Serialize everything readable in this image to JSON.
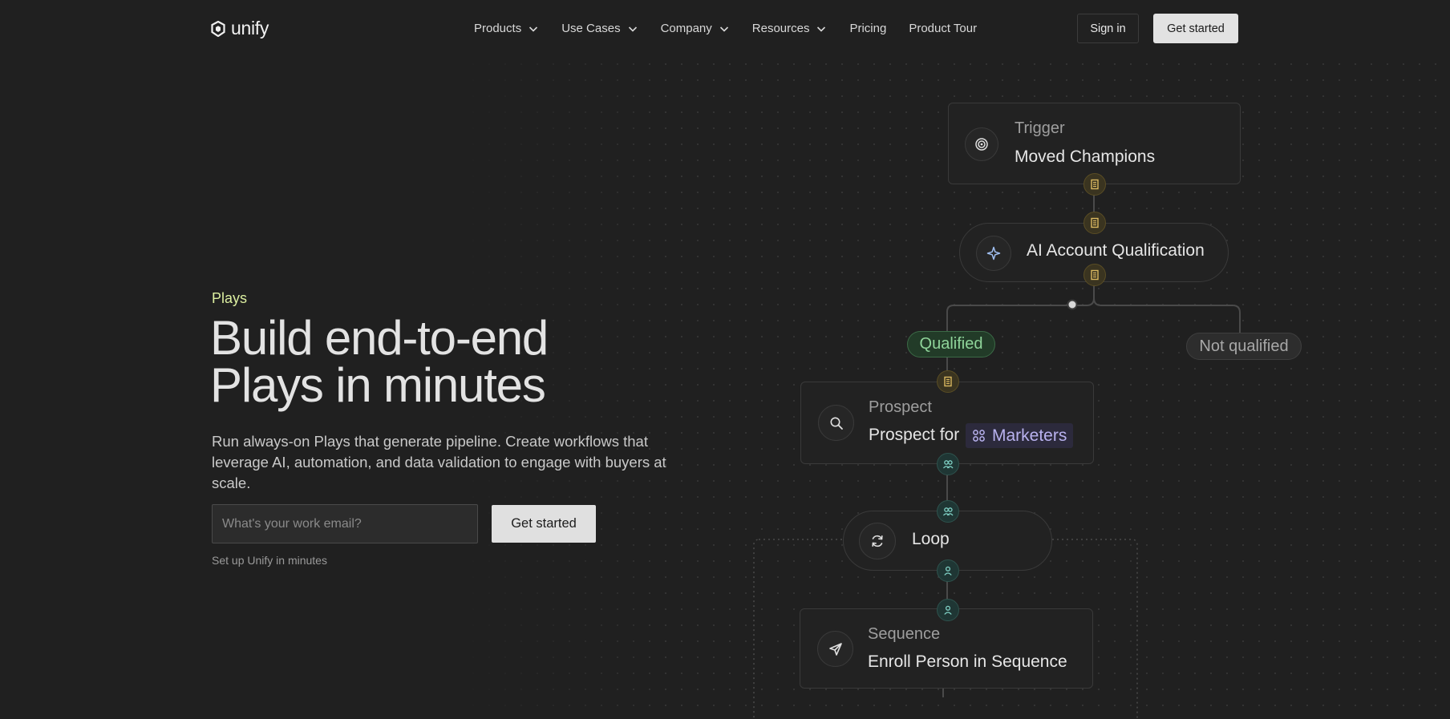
{
  "brand": {
    "name": "unify"
  },
  "nav": {
    "items": [
      {
        "label": "Products",
        "has_dropdown": true
      },
      {
        "label": "Use Cases",
        "has_dropdown": true
      },
      {
        "label": "Company",
        "has_dropdown": true
      },
      {
        "label": "Resources",
        "has_dropdown": true
      },
      {
        "label": "Pricing",
        "has_dropdown": false
      },
      {
        "label": "Product Tour",
        "has_dropdown": false
      }
    ],
    "sign_in": "Sign in",
    "get_started": "Get started"
  },
  "hero": {
    "eyebrow": "Plays",
    "headline_line1": "Build end-to-end",
    "headline_line2": "Plays in minutes",
    "subtext": "Run always-on Plays that generate pipeline. Create workflows that leverage AI, automation, and data validation to engage with buyers at scale.",
    "email_placeholder": "What's your work email?",
    "email_value": "",
    "cta": "Get started",
    "note": "Set up Unify in minutes"
  },
  "flow": {
    "trigger": {
      "label": "Trigger",
      "value": "Moved Champions",
      "icon": "target-icon"
    },
    "qualification": {
      "value": "AI Account Qualification",
      "icon": "sparkle-icon"
    },
    "branch_yes": "Qualified",
    "branch_no": "Not qualified",
    "prospect": {
      "label": "Prospect",
      "value": "Prospect for",
      "tag": "Marketers",
      "icon": "search-icon"
    },
    "loop": {
      "value": "Loop",
      "icon": "loop-icon"
    },
    "sequence": {
      "label": "Sequence",
      "value": "Enroll Person in Sequence",
      "icon": "send-icon"
    }
  },
  "colors": {
    "background": "#202020",
    "eyebrow": "#dcefa0",
    "qualified_green": "#8fd49a",
    "tag_purple": "#b9b2ef",
    "port_gold": "#d9b860",
    "port_teal": "#7fd0c4"
  }
}
